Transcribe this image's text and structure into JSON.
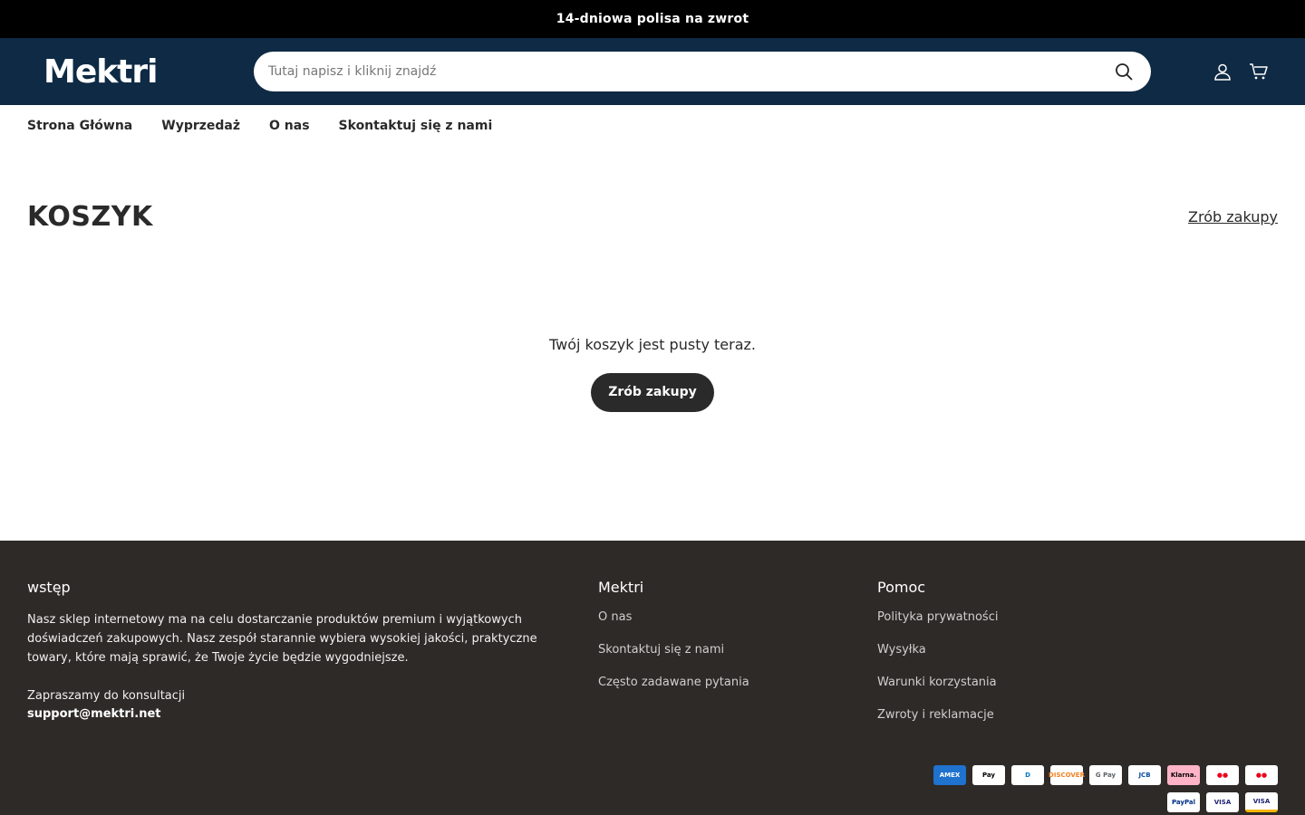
{
  "announcement": {
    "text": "14-dniowa polisa na zwrot"
  },
  "header": {
    "logo": "Mektri",
    "search_placeholder": "Tutaj napisz i kliknij znajdź",
    "icons": [
      "search-icon",
      "account-icon",
      "cart-icon"
    ]
  },
  "nav": {
    "items": [
      {
        "label": "Strona Główna"
      },
      {
        "label": "Wyprzedaż"
      },
      {
        "label": "O nas"
      },
      {
        "label": "Skontaktuj się z nami"
      }
    ]
  },
  "cart": {
    "title": "KOSZYK",
    "continue_link": "Zrób zakupy",
    "empty_text": "Twój koszyk jest pusty teraz.",
    "empty_button": "Zrób zakupy"
  },
  "footer": {
    "col1": {
      "heading": "wstęp",
      "description": "Nasz sklep internetowy ma na celu dostarczanie produktów premium i wyjątkowych doświadczeń zakupowych. Nasz zespół starannie wybiera wysokiej jakości, praktyczne towary, które mają sprawić, że Twoje życie będzie wygodniejsze.",
      "consult": "Zapraszamy do konsultacji⁠",
      "email": "support@mektri.net"
    },
    "col2": {
      "heading": "Mektri",
      "links": [
        "O nas",
        "Skontaktuj się z nami",
        "Często zadawane pytania"
      ]
    },
    "col3": {
      "heading": "Pomoc",
      "links": [
        "Polityka prywatności",
        "Wysyłka",
        "Warunki korzystania",
        "Zwroty i reklamacje"
      ]
    },
    "payments": [
      {
        "name": "American Express",
        "label": "AMEX",
        "color": "#1f72cd"
      },
      {
        "name": "Apple Pay",
        "label": "Pay",
        "color": "#000000"
      },
      {
        "name": "Diners Club",
        "label": "D",
        "color": "#0079be"
      },
      {
        "name": "Discover",
        "label": "DISCOVER",
        "color": "#f48120"
      },
      {
        "name": "Google Pay",
        "label": "G Pay",
        "color": "#5f6368"
      },
      {
        "name": "JCB",
        "label": "JCB",
        "color": "#0b4ea2"
      },
      {
        "name": "Klarna",
        "label": "Klarna.",
        "color": "#ffb3c7"
      },
      {
        "name": "Maestro",
        "label": "●●",
        "color": "#eb001b"
      },
      {
        "name": "Mastercard",
        "label": "●●",
        "color": "#eb001b"
      },
      {
        "name": "PayPal",
        "label": "PayPal",
        "color": "#003087"
      },
      {
        "name": "Visa",
        "label": "VISA",
        "color": "#1a1f71"
      },
      {
        "name": "Visa Electron",
        "label": "VISA",
        "color": "#1a1f71"
      }
    ]
  }
}
